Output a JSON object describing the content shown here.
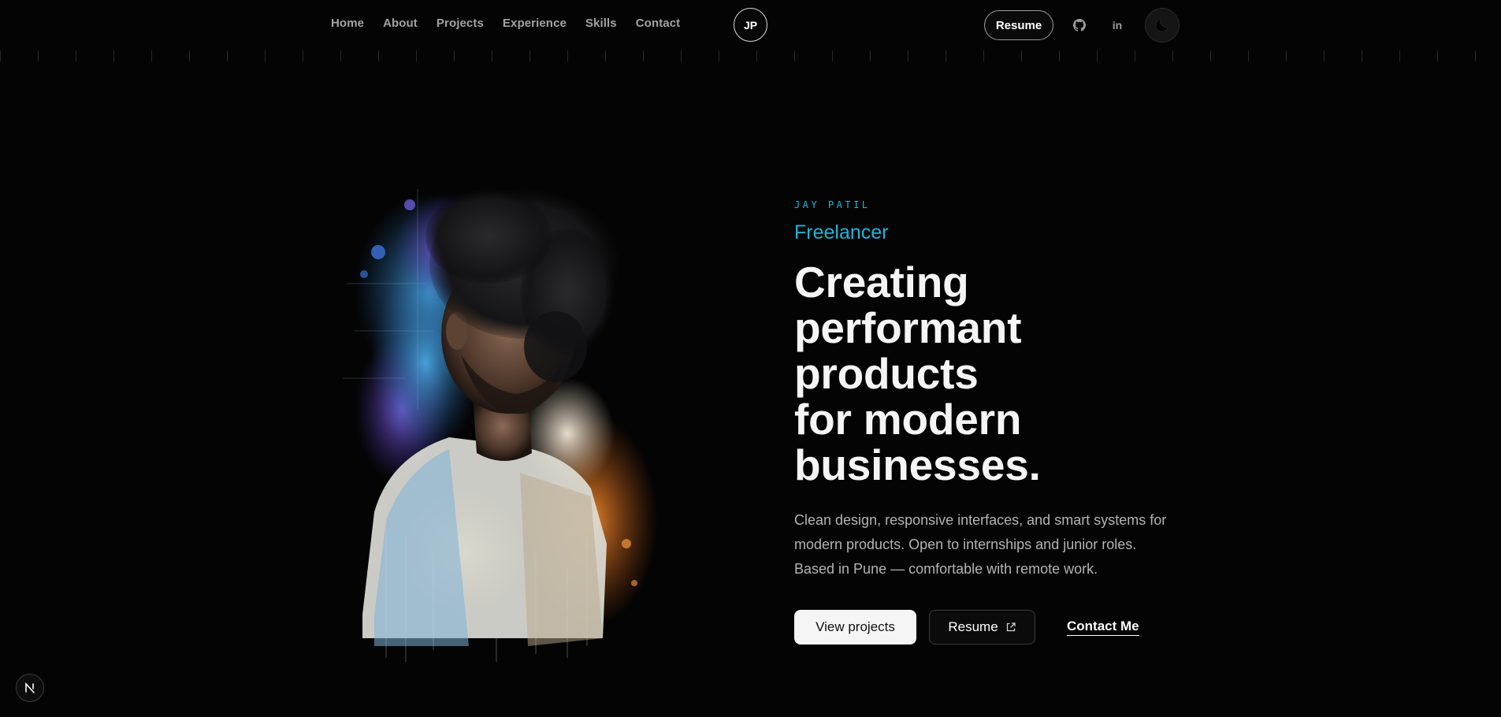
{
  "nav": {
    "links": [
      "Home",
      "About",
      "Projects",
      "Experience",
      "Skills",
      "Contact"
    ],
    "logo": "JP",
    "resume_label": "Resume",
    "icons": [
      "github-icon",
      "linkedin-icon",
      "moon-icon"
    ],
    "linkedin_glyph": "in"
  },
  "hero": {
    "eyebrow": "JAY PATIL",
    "role": "Freelancer",
    "headline": [
      "Creating",
      "performant",
      "products",
      "for modern",
      "businesses."
    ],
    "lead": [
      "Clean design, responsive interfaces, and smart systems for",
      "modern products. Open to internships and junior roles.",
      "Based in Pune — comfortable with remote work."
    ],
    "cta_primary": "View projects",
    "cta_secondary": "Resume",
    "cta_link": "Contact Me"
  },
  "colors": {
    "background": "#040404",
    "accent": "#22b5d6",
    "text": "#f5f5f5",
    "muted": "#b4b4b4"
  },
  "dev_badge": "N"
}
